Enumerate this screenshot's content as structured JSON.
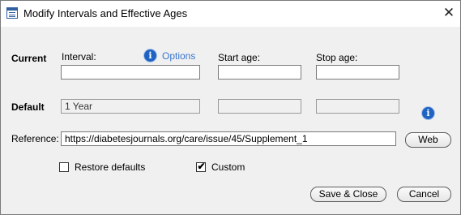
{
  "window": {
    "title": "Modify Intervals and Effective Ages",
    "close_glyph": "✕"
  },
  "rows": {
    "current_label": "Current",
    "default_label": "Default"
  },
  "columns": {
    "interval_label": "Interval:",
    "options_link": "Options",
    "start_age_label": "Start age:",
    "stop_age_label": "Stop age:"
  },
  "current": {
    "interval": "",
    "start_age": "",
    "stop_age": ""
  },
  "default": {
    "interval": "1 Year",
    "start_age": "",
    "stop_age": ""
  },
  "reference": {
    "label": "Reference:",
    "value": "https://diabetesjournals.org/care/issue/45/Supplement_1",
    "web_button": "Web"
  },
  "checkboxes": {
    "restore_defaults": {
      "label": "Restore defaults",
      "checked": false
    },
    "custom": {
      "label": "Custom",
      "checked": true
    }
  },
  "buttons": {
    "save_close": "Save & Close",
    "cancel": "Cancel"
  },
  "icons": {
    "info": "i",
    "check": "✔"
  },
  "colors": {
    "link": "#3a76cc",
    "info": "#1e63c4"
  }
}
